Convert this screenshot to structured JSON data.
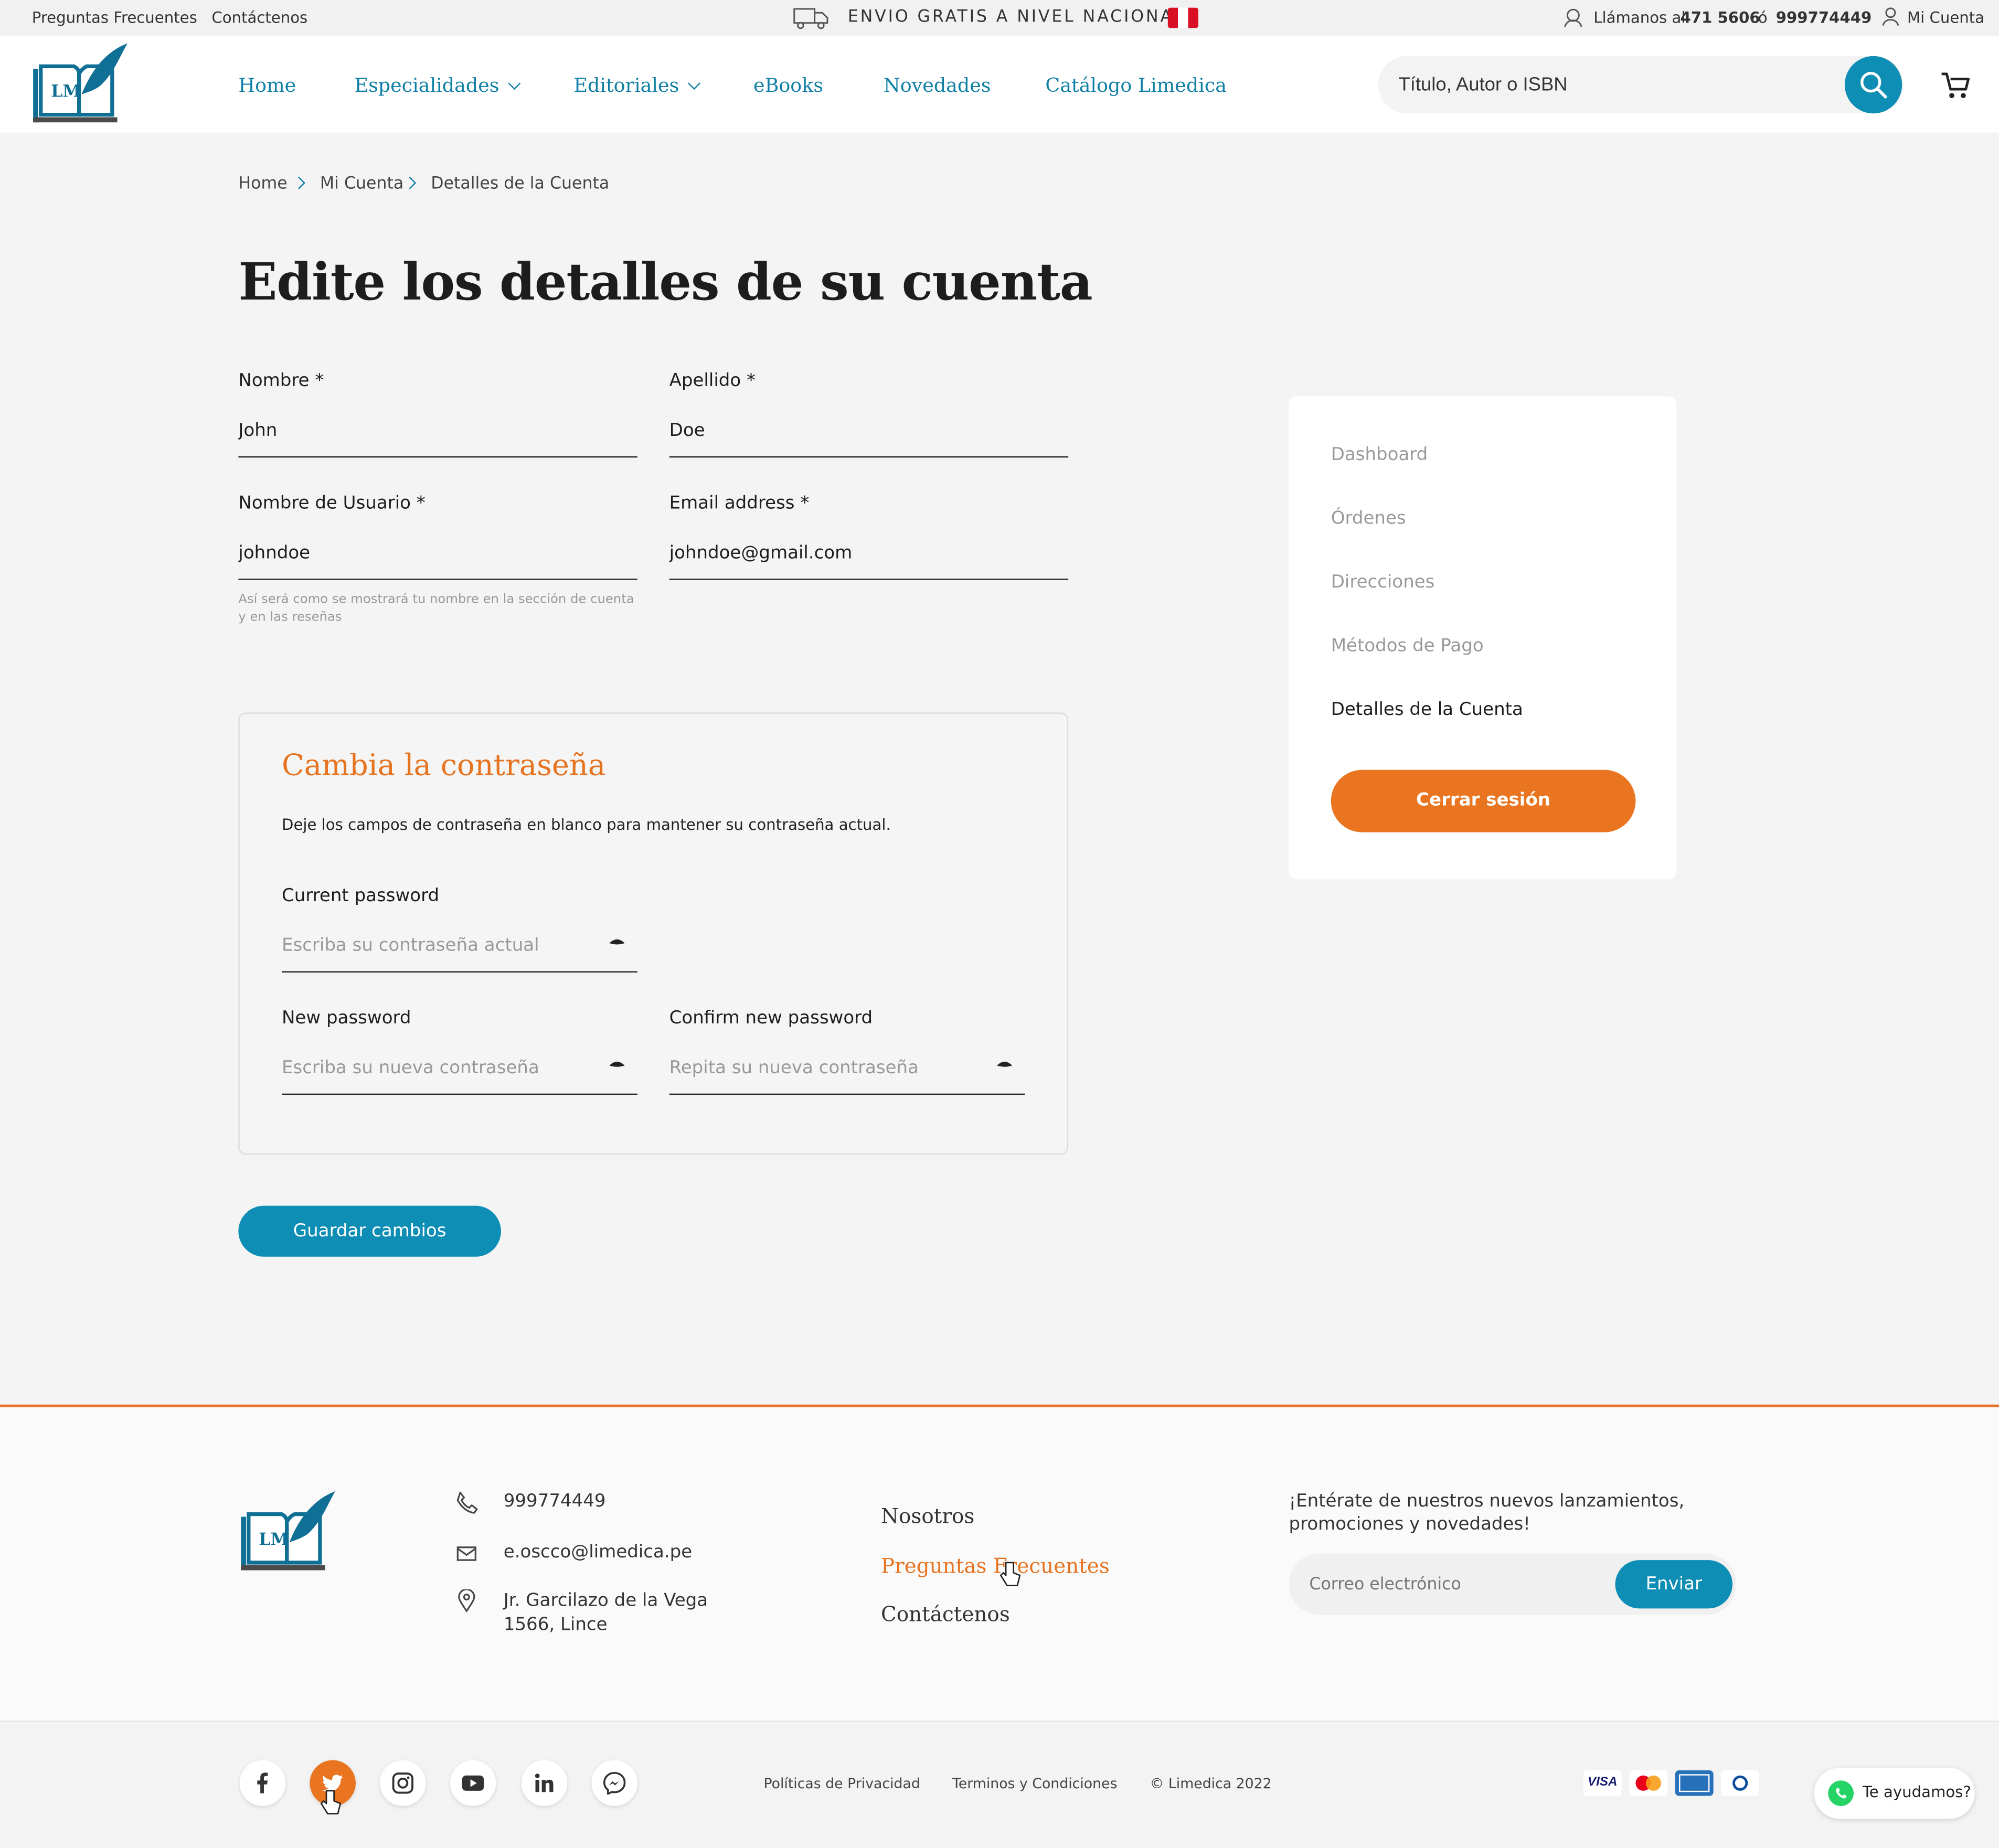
{
  "topbar": {
    "faq": "Preguntas Frecuentes",
    "contact": "Contáctenos",
    "shipping": "ENVIO GRATIS A NIVEL NACIONAL",
    "call_label": "Llámanos al",
    "phone1": "471 5606",
    "or": "ó",
    "phone2": "999774449",
    "account": "Mi Cuenta"
  },
  "header": {
    "logo_text": "LM",
    "nav": [
      {
        "label": "Home"
      },
      {
        "label": "Especialidades"
      },
      {
        "label": "Editoriales"
      },
      {
        "label": "eBooks"
      },
      {
        "label": "Novedades"
      },
      {
        "label": "Catálogo Limedica"
      }
    ],
    "search_placeholder": "Título, Autor o ISBN"
  },
  "breadcrumb": [
    "Home",
    "Mi Cuenta",
    "Detalles de la Cuenta"
  ],
  "page_title": "Edite los detalles de su cuenta",
  "form": {
    "first_name_label": "Nombre *",
    "first_name": "John",
    "last_name_label": "Apellido *",
    "last_name": "Doe",
    "username_label": "Nombre de Usuario *",
    "username": "johndoe",
    "username_hint": "Así será como se mostrará tu nombre en la sección de cuenta y en las reseñas",
    "email_label": "Email address *",
    "email": "johndoe@gmail.com"
  },
  "password": {
    "title": "Cambia la contraseña",
    "desc": "Deje los campos de contraseña en blanco para mantener su contraseña actual.",
    "current_label": "Current password",
    "current_placeholder": "Escriba su contraseña actual",
    "new_label": "New password",
    "new_placeholder": "Escriba su nueva contraseña",
    "confirm_label": "Confirm new password",
    "confirm_placeholder": "Repita su nueva contraseña"
  },
  "save_button": "Guardar cambios",
  "sidebar": {
    "items": [
      "Dashboard",
      "Órdenes",
      "Direcciones",
      "Métodos de Pago",
      "Detalles de la Cuenta"
    ],
    "active": "Detalles de la Cuenta",
    "logout": "Cerrar sesión"
  },
  "footer": {
    "phone": "999774449",
    "email": "e.oscco@limedica.pe",
    "address_line1": "Jr. Garcilazo de la Vega",
    "address_line2": "1566, Lince",
    "links": [
      "Nosotros",
      "Preguntas Frecuentes",
      "Contáctenos"
    ],
    "newsletter_text_1": "¡Entérate de nuestros nuevos lanzamientos,",
    "newsletter_text_2": "promociones y novedades!",
    "newsletter_placeholder": "Correo electrónico",
    "newsletter_button": "Enviar",
    "privacy": "Políticas de Privacidad",
    "terms": "Terminos y Condiciones",
    "copyright": "© Limedica 2022",
    "chat": "Te ayudamos?",
    "social_icons": [
      "facebook-icon",
      "twitter-icon",
      "instagram-icon",
      "youtube-icon",
      "linkedin-icon",
      "messenger-icon"
    ],
    "payment_icons": [
      "visa-icon",
      "mastercard-icon",
      "amex-icon",
      "diners-icon"
    ]
  },
  "colors": {
    "primary": "#0e8db5",
    "accent": "#ea7520",
    "nav_text": "#0f7fa6"
  }
}
